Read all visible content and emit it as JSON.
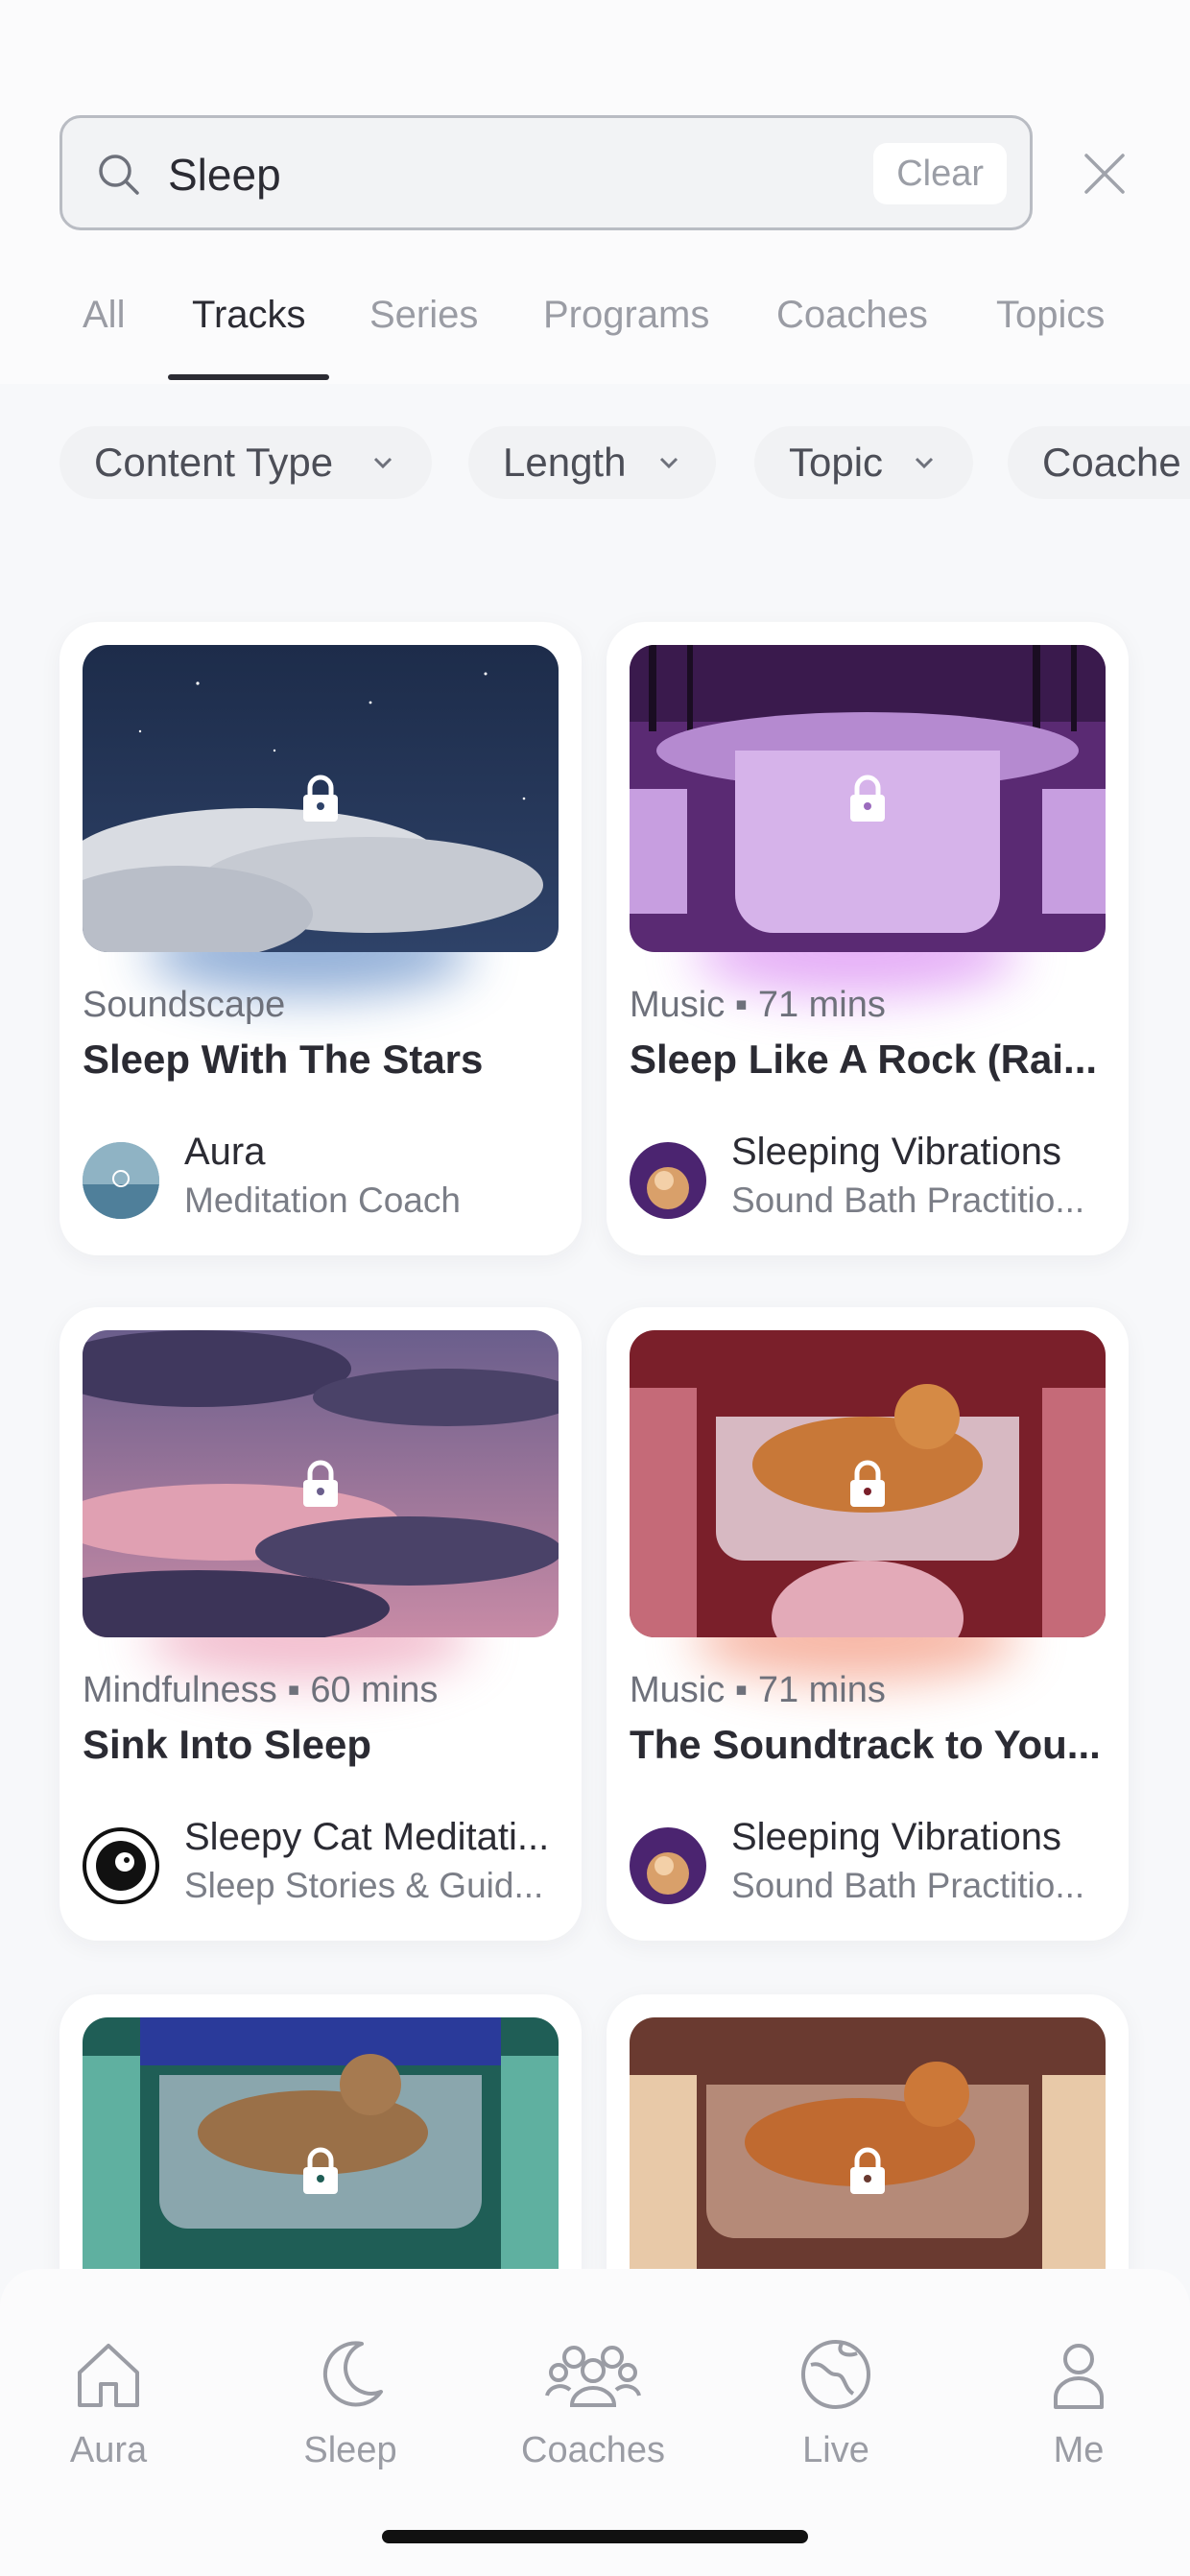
{
  "search": {
    "query": "Sleep",
    "clear_label": "Clear"
  },
  "tabs": [
    "All",
    "Tracks",
    "Series",
    "Programs",
    "Coaches",
    "Topics"
  ],
  "active_tab": "Tracks",
  "filters": [
    "Content Type",
    "Length",
    "Topic",
    "Coache"
  ],
  "cards": [
    {
      "meta": "Soundscape",
      "title": "Sleep With The Stars",
      "coach": "Aura",
      "role": "Meditation Coach"
    },
    {
      "meta": "Music ▪ 71 mins",
      "title": "Sleep Like A Rock (Rai...",
      "coach": "Sleeping Vibrations",
      "role": "Sound Bath Practitio..."
    },
    {
      "meta": "Mindfulness ▪ 60 mins",
      "title": "Sink Into Sleep",
      "coach": "Sleepy Cat Meditati...",
      "role": "Sleep Stories & Guid..."
    },
    {
      "meta": "Music ▪ 71 mins",
      "title": "The Soundtrack to You...",
      "coach": "Sleeping Vibrations",
      "role": "Sound Bath Practitio..."
    },
    {
      "meta": "",
      "title": "",
      "coach": "",
      "role": ""
    },
    {
      "meta": "",
      "title": "",
      "coach": "",
      "role": ""
    }
  ],
  "nav": [
    "Aura",
    "Sleep",
    "Coaches",
    "Live",
    "Me"
  ],
  "colors": {
    "accent_text": "#2b2b33",
    "muted": "#9a9ca4",
    "background": "#f7f8fa"
  }
}
